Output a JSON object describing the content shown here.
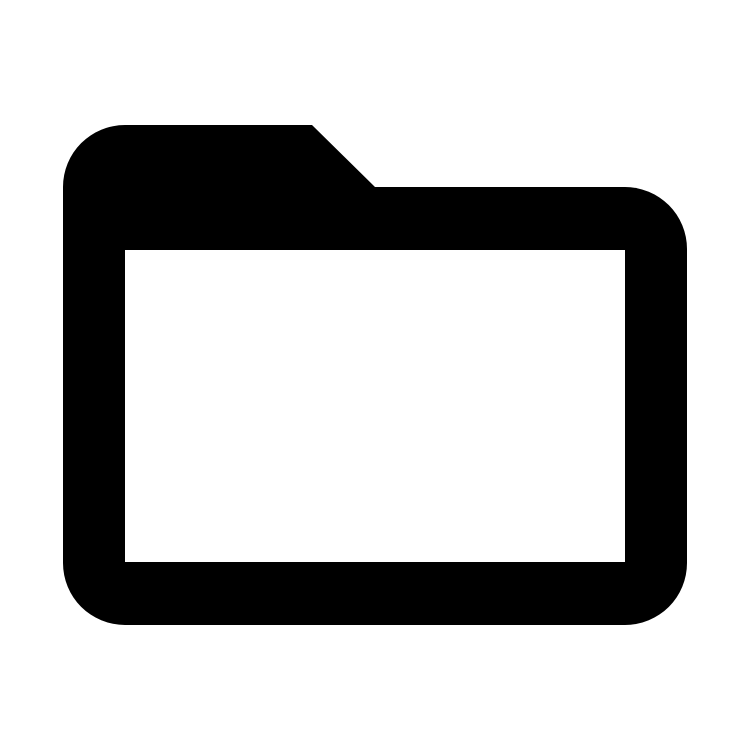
{
  "icon": {
    "name": "folder-icon",
    "style": "outlined"
  },
  "colors": {
    "background": "#ffffff",
    "icon": "#000000"
  }
}
